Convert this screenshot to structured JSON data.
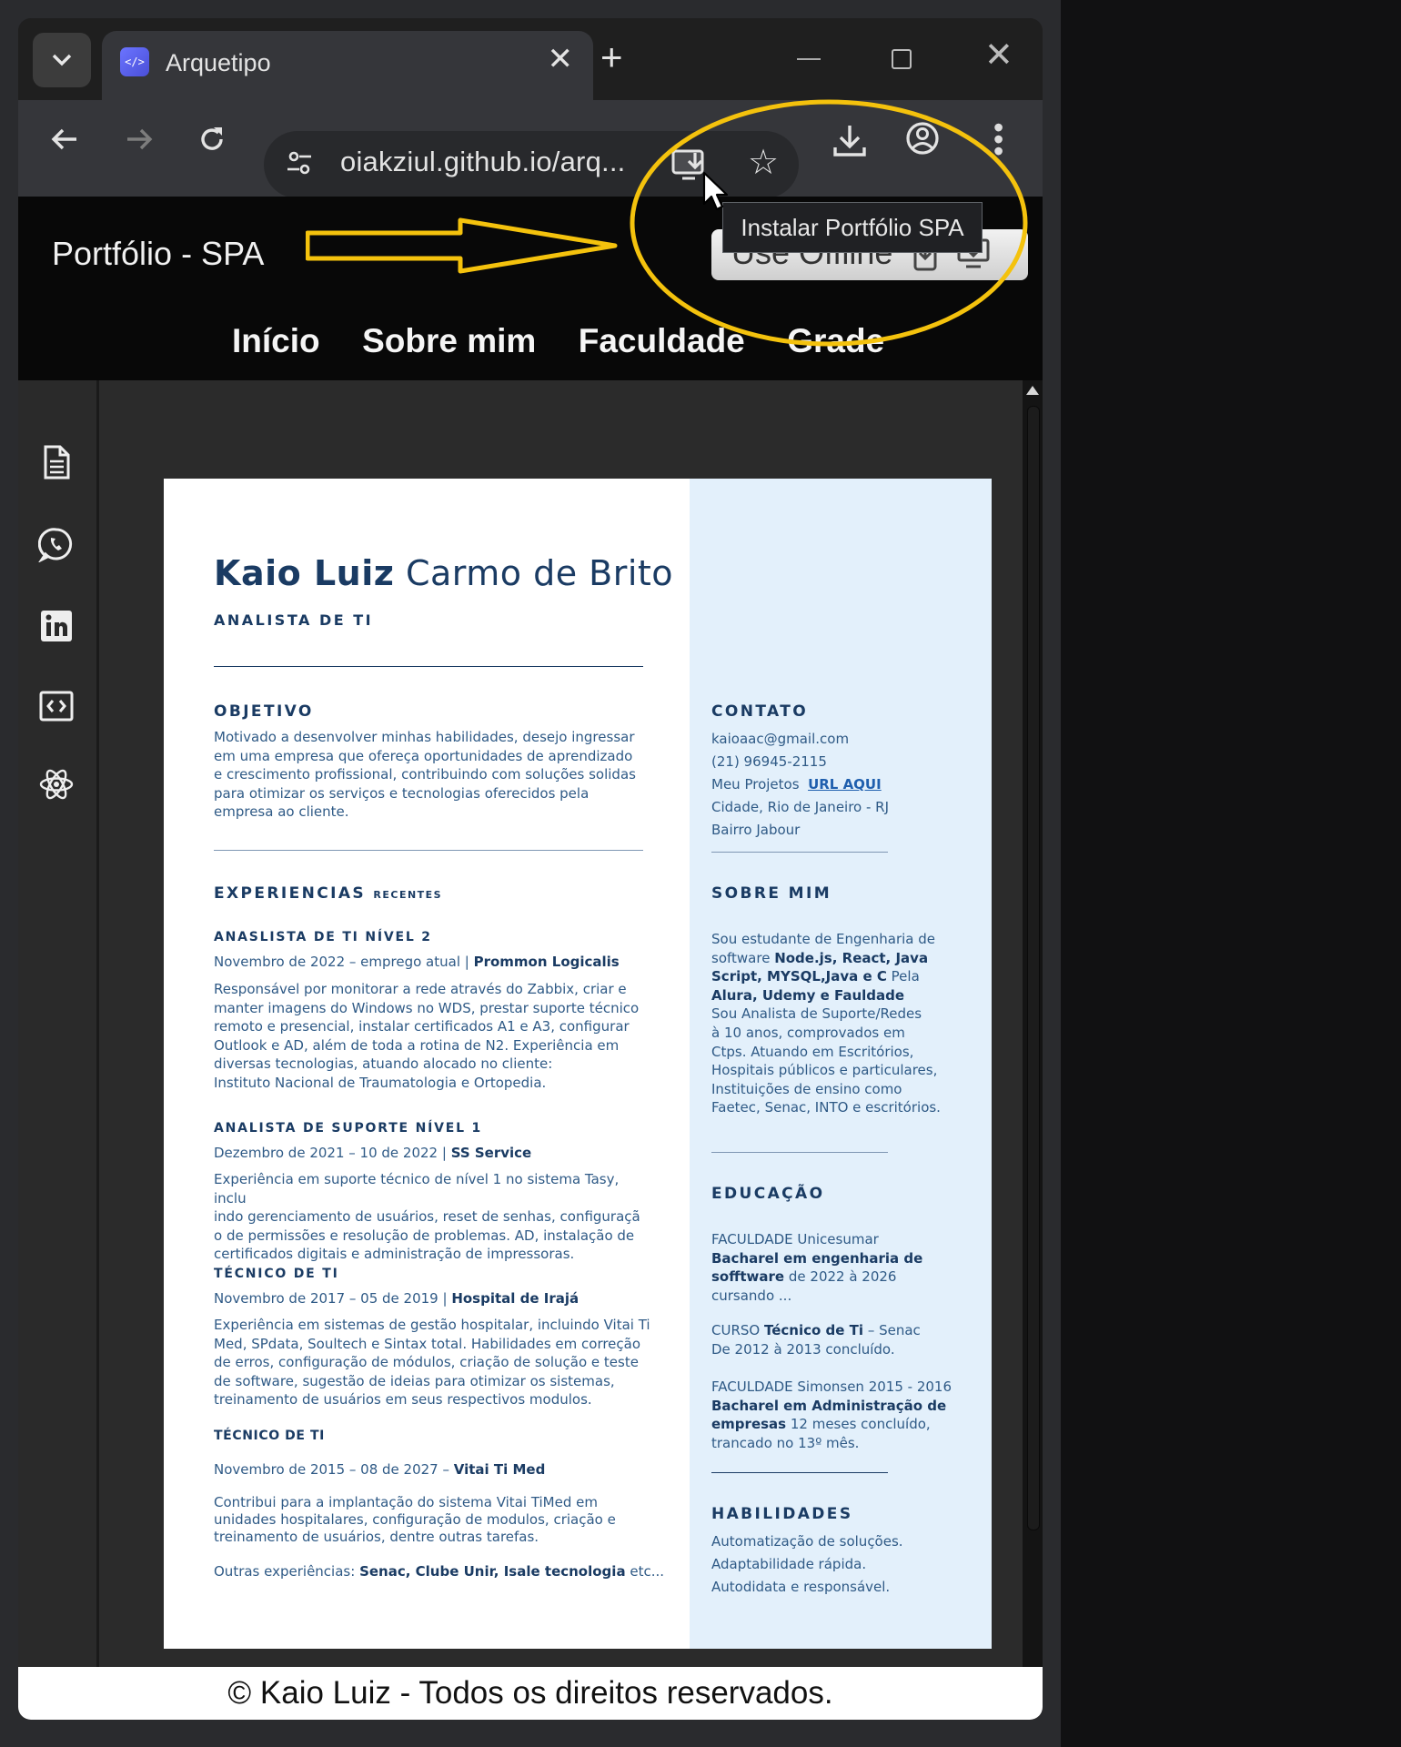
{
  "browser": {
    "tab_title": "Arquetipo",
    "favicon_text": "</>",
    "url": "oiakziul.github.io/arq...",
    "tooltip": "Instalar Portfólio SPA"
  },
  "site": {
    "title": "Portfólio - SPA",
    "offline_button": "Use Offline",
    "nav": [
      "Início",
      "Sobre mim",
      "Faculdade",
      "Grade"
    ],
    "sidebar_icons": [
      "document-icon",
      "whatsapp-icon",
      "linkedin-icon",
      "code-icon",
      "react-icon"
    ],
    "footer": "© Kaio Luiz - Todos os direitos reservados."
  },
  "resume": {
    "name_bold": "Kaio Luiz",
    "name_rest": "Carmo de Brito",
    "role": "ANALISTA DE TI",
    "objective": {
      "heading": "OBJETIVO",
      "lines": [
        "Motivado a desenvolver minhas habilidades, desejo ingressar",
        "em uma empresa que ofereça oportunidades de aprendizado",
        "e crescimento profissional, contribuindo com soluções solidas",
        "para otimizar os serviços e tecnologias oferecidos pela",
        "empresa ao cliente."
      ]
    },
    "experience_heading": "EXPERIENCIAS",
    "experience_sub": "RECENTES",
    "jobs": [
      {
        "title": "ANASLISTA DE TI NÍVEL 2",
        "period": "Novembro de 2022 – emprego atual  |",
        "company": "Prommon Logicalis",
        "lines": [
          "Responsável por monitorar a rede através do Zabbix, criar e",
          "manter imagens do Windows no WDS, prestar suporte técnico",
          "remoto e presencial, instalar certificados A1 e A3, configurar",
          "Outlook e AD, além de toda a rotina de N2. Experiência em",
          "diversas tecnologias, atuando alocado no cliente:",
          "Instituto Nacional de Traumatologia e Ortopedia."
        ]
      },
      {
        "title": "ANALISTA DE SUPORTE NÍVEL 1",
        "period": "Dezembro de 2021 – 10 de 2022  |",
        "company": "SS Service",
        "lines": [
          "Experiência em suporte técnico de nível 1 no sistema Tasy, inclu",
          "indo gerenciamento de usuários, reset de senhas, configuraçã",
          "o de permissões e resolução de problemas. AD, instalação de",
          "certificados digitais e administração de impressoras."
        ]
      },
      {
        "title": "TÉCNICO DE TI",
        "period": "Novembro de 2017 – 05 de 2019 |",
        "company": "Hospital de Irajá",
        "lines": [
          "Experiência em sistemas de gestão hospitalar, incluindo Vitai Ti",
          "Med, SPdata, Soultech e Sintax total. Habilidades em correção",
          "de erros, configuração de módulos, criação de solução e teste",
          "de software, sugestão de ideias para otimizar os sistemas,",
          "treinamento de usuários em seus respectivos modulos."
        ]
      },
      {
        "title": "TÉCNICO DE TI",
        "period": "Novembro de 2015 – 08 de 2027 –",
        "company": "Vitai Ti Med",
        "lines": [
          "Contribui para a implantação do sistema Vitai TiMed em",
          "unidades hospitalares, configuração de modulos, criação e",
          "treinamento de usuários, dentre outras tarefas."
        ]
      }
    ],
    "other_prefix": "Outras experiências:",
    "other_bold": "Senac, Clube Unir, Isale tecnologia",
    "other_suffix": "etc...",
    "contact": {
      "heading": "CONTATO",
      "email": "kaioaac@gmail.com",
      "phone": "(21) 96945-2115",
      "projects_label": "Meu Projetos",
      "projects_link": "URL AQUI",
      "city": "Cidade, Rio de Janeiro -  RJ",
      "district": "Bairro Jabour"
    },
    "about": {
      "heading": "SOBRE MIM",
      "l1": "Sou estudante de Engenharia de",
      "l2a": "software ",
      "l2b": "Node.js, React, Java",
      "l3a": "Script, MYSQL,Java e C",
      "l3b": " Pela",
      "l4": "Alura, Udemy e Fauldade",
      "rest": [
        "Sou Analista de Suporte/Redes",
        "à 10 anos, comprovados em",
        "Ctps. Atuando em Escritórios,",
        "Hospitais públicos e particulares,",
        "Instituições de ensino como",
        "Faetec, Senac, INTO e escritórios."
      ]
    },
    "education": {
      "heading": "EDUCAÇÃO",
      "e1_l1": "FACULDADE Unicesumar",
      "e1_l2": "Bacharel em engenharia de",
      "e1_l3a": "sofftware",
      "e1_l3b": " de 2022 à 2026",
      "e1_l4": "cursando ...",
      "e2_l1a": "CURSO ",
      "e2_l1b": "Técnico de Ti",
      "e2_l1c": " – Senac",
      "e2_l2": "De 2012 à 2013 concluído.",
      "e3_l1": "FACULDADE Simonsen 2015 - 2016",
      "e3_l2": "Bacharel em Administração de",
      "e3_l3a": "empresas",
      "e3_l3b": " 12 meses concluído,",
      "e3_l4": "trancado no 13º mês."
    },
    "skills": {
      "heading": "HABILIDADES",
      "items": [
        "Automatização de soluções.",
        "Adaptabilidade rápida.",
        "Autodidata e responsável."
      ]
    }
  },
  "colors": {
    "accent_annotation": "#f4c20d",
    "resume_navy": "#1a3b63",
    "resume_panel": "#e3f0fb"
  }
}
